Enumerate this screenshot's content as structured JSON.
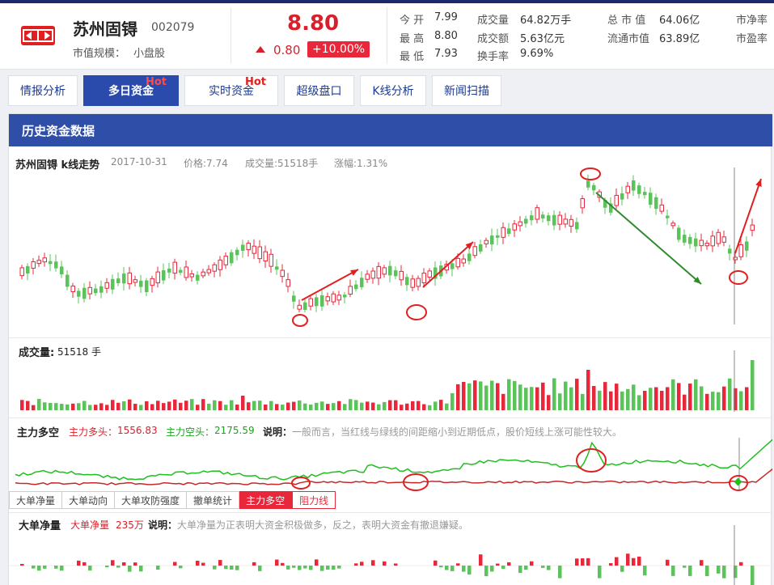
{
  "stock": {
    "name": "苏州固锝",
    "code": "002079",
    "mcap_label": "市值规模：",
    "mcap_value": "小盘股",
    "price": "8.80",
    "change": "0.80",
    "change_pct": "+10.00%"
  },
  "stats": {
    "col1": [
      {
        "label": "今 开",
        "value": "7.99"
      },
      {
        "label": "最 高",
        "value": "8.80"
      },
      {
        "label": "最 低",
        "value": "7.93"
      }
    ],
    "col2": [
      {
        "label": "成交量",
        "value": "64.82万手"
      },
      {
        "label": "成交额",
        "value": "5.63亿元"
      },
      {
        "label": "换手率",
        "value": "9.69%"
      }
    ],
    "col3": [
      {
        "label": "总 市 值",
        "value": "64.06亿"
      },
      {
        "label": "流通市值",
        "value": "63.89亿"
      }
    ],
    "col4": [
      {
        "label": "市净率"
      },
      {
        "label": "市盈率"
      }
    ]
  },
  "tabs": [
    {
      "label": "情报分析",
      "hot": ""
    },
    {
      "label": "多日资金",
      "hot": "Hot"
    },
    {
      "label": "实时资金",
      "hot": "Hot"
    },
    {
      "label": "超级盘口",
      "hot": ""
    },
    {
      "label": "K线分析",
      "hot": ""
    },
    {
      "label": "新闻扫描",
      "hot": ""
    }
  ],
  "panel": {
    "title": "历史资金数据",
    "kline_title": "苏州固锝 k线走势",
    "date": "2017-10-31",
    "price_info": "价格:7.74",
    "volume_info": "成交量:51518手",
    "change_info": "涨幅:1.31%"
  },
  "volume_section": {
    "label": "成交量:",
    "value": "51518 手"
  },
  "main_force": {
    "label": "主力多空",
    "long_label": "主力多头：",
    "long_value": "1556.83",
    "short_label": "主力空头：",
    "short_value": "2175.59",
    "note_label": "说明：",
    "note_text": "一般而言，当红线与绿线的间距缩小到近期低点，股价短线上涨可能性较大。"
  },
  "subtabs": [
    {
      "label": "大单净量",
      "state": "normal"
    },
    {
      "label": "大单动向",
      "state": "normal"
    },
    {
      "label": "大单攻防强度",
      "state": "normal"
    },
    {
      "label": "撤单统计",
      "state": "normal"
    },
    {
      "label": "主力多空",
      "state": "active"
    },
    {
      "label": "阻力线",
      "state": "outlined"
    }
  ],
  "big_order": {
    "label": "大单净量",
    "net_label": "大单净量",
    "net_value": "235万",
    "note_label": "说明：",
    "note_text": "大单净量为正表明大资金积极做多，反之，表明大资金有撤退嫌疑。"
  },
  "colors": {
    "up": "#e8283a",
    "down": "#5ac35a",
    "brand": "#2f4ea8"
  }
}
